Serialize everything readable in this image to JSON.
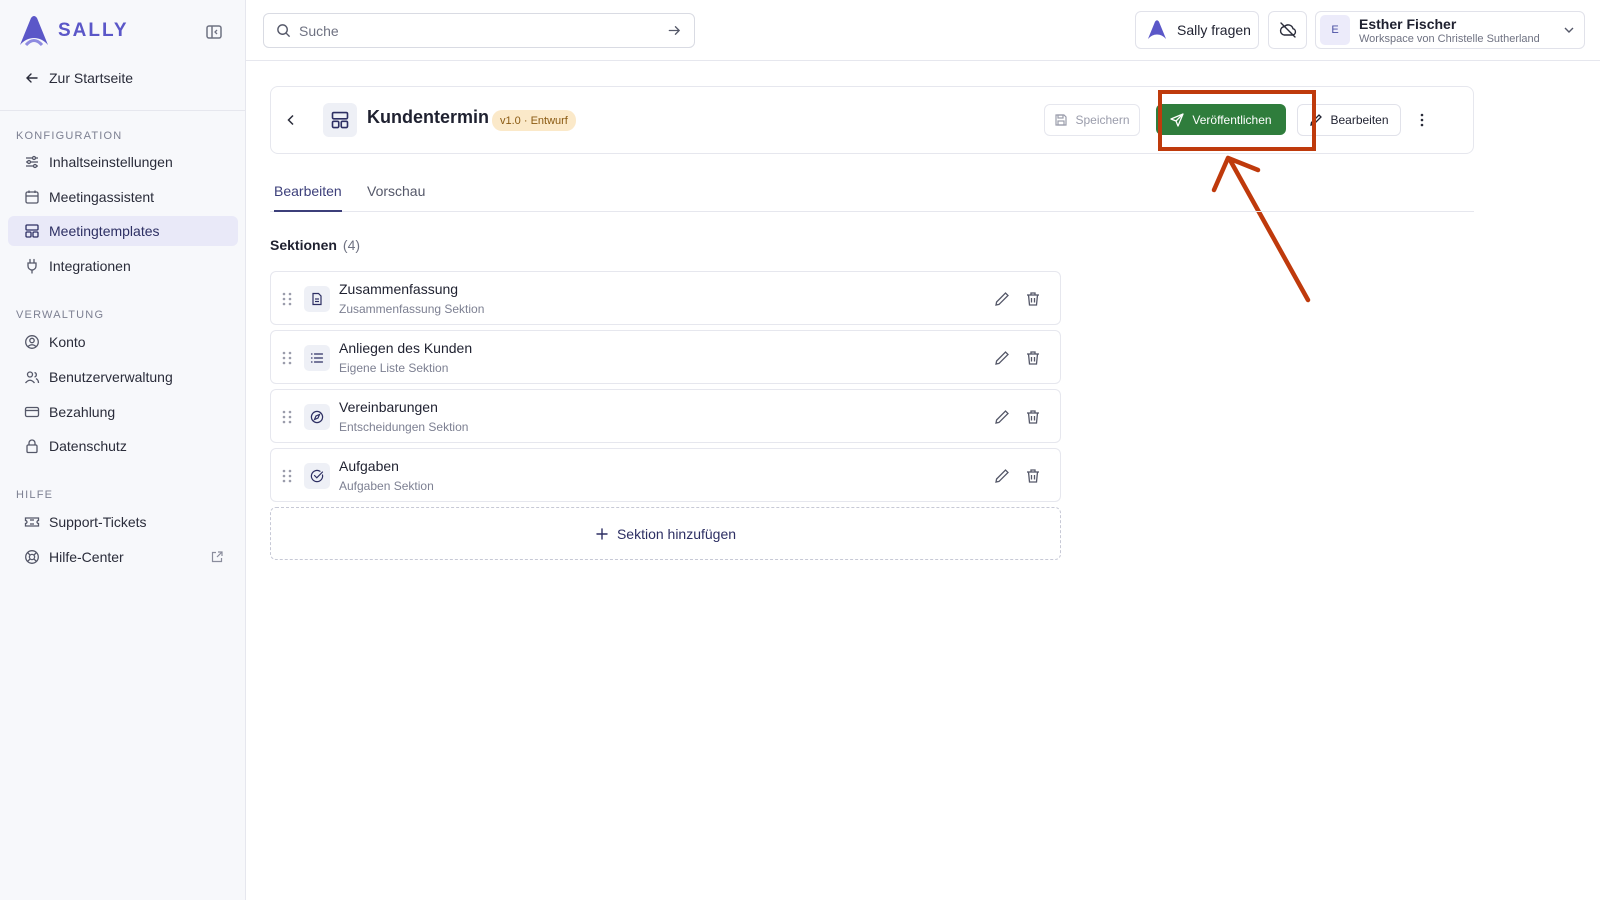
{
  "brand": {
    "name": "SALLY"
  },
  "sidebar": {
    "home_label": "Zur Startseite",
    "sections": [
      {
        "title": "KONFIGURATION",
        "items": [
          {
            "label": "Inhaltseinstellungen",
            "icon": "sliders-icon"
          },
          {
            "label": "Meetingassistent",
            "icon": "calendar-icon"
          },
          {
            "label": "Meetingtemplates",
            "icon": "template-icon",
            "active": true
          },
          {
            "label": "Integrationen",
            "icon": "plug-icon"
          }
        ]
      },
      {
        "title": "VERWALTUNG",
        "items": [
          {
            "label": "Konto",
            "icon": "user-circle-icon"
          },
          {
            "label": "Benutzerverwaltung",
            "icon": "users-icon"
          },
          {
            "label": "Bezahlung",
            "icon": "credit-card-icon"
          },
          {
            "label": "Datenschutz",
            "icon": "lock-icon"
          }
        ]
      },
      {
        "title": "HILFE",
        "items": [
          {
            "label": "Support-Tickets",
            "icon": "ticket-icon"
          },
          {
            "label": "Hilfe-Center",
            "icon": "lifebuoy-icon"
          }
        ]
      }
    ]
  },
  "topbar": {
    "search_placeholder": "Suche",
    "ask_label": "Sally fragen",
    "user": {
      "initial": "E",
      "name": "Esther Fischer",
      "workspace": "Workspace von Christelle Sutherland"
    }
  },
  "template": {
    "title": "Kundentermin",
    "version_badge": "v1.0 · Entwurf",
    "save_label": "Speichern",
    "publish_label": "Veröffentlichen",
    "edit_label": "Bearbeiten"
  },
  "tabs": [
    {
      "label": "Bearbeiten",
      "active": true
    },
    {
      "label": "Vorschau",
      "active": false
    }
  ],
  "sections_header": {
    "title": "Sektionen",
    "count": "(4)"
  },
  "sections": [
    {
      "name": "Zusammenfassung",
      "type": "Zusammenfassung Sektion",
      "icon": "document-icon"
    },
    {
      "name": "Anliegen des Kunden",
      "type": "Eigene Liste Sektion",
      "icon": "list-icon"
    },
    {
      "name": "Vereinbarungen",
      "type": "Entscheidungen Sektion",
      "icon": "compass-icon"
    },
    {
      "name": "Aufgaben",
      "type": "Aufgaben Sektion",
      "icon": "check-circle-icon"
    }
  ],
  "add_section_label": "Sektion hinzufügen",
  "colors": {
    "accent": "#5b57c8",
    "publish": "#2f7d3c",
    "annotation": "#bf3a0c",
    "badge_bg": "#fbe9c9"
  }
}
